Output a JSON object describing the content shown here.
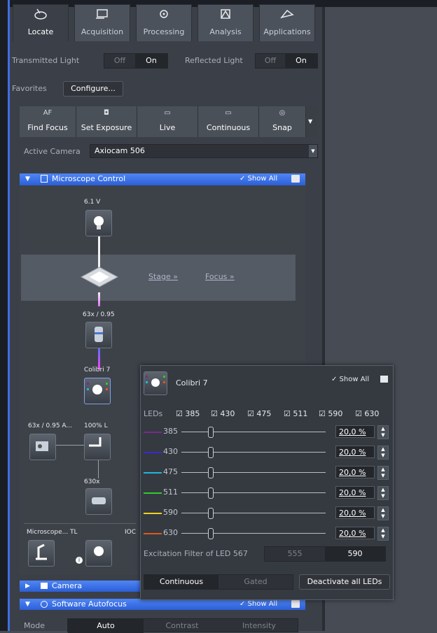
{
  "tabs": [
    {
      "label": "Locate",
      "icon": "locate-icon"
    },
    {
      "label": "Acquisition",
      "icon": "acquisition-icon"
    },
    {
      "label": "Processing",
      "icon": "processing-icon"
    },
    {
      "label": "Analysis",
      "icon": "analysis-icon"
    },
    {
      "label": "Applications",
      "icon": "applications-icon"
    }
  ],
  "light": {
    "transmitted_label": "Transmitted Light",
    "reflected_label": "Reflected Light",
    "off": "Off",
    "on": "On"
  },
  "favorites": {
    "label": "Favorites",
    "configure": "Configure..."
  },
  "toolbar": [
    {
      "icon_text": "AF",
      "label": "Find Focus"
    },
    {
      "icon_text": "◘",
      "label": "Set Exposure"
    },
    {
      "icon_text": "▭",
      "label": "Live"
    },
    {
      "icon_text": "▭",
      "label": "Continuous"
    },
    {
      "icon_text": "◎",
      "label": "Snap"
    }
  ],
  "camera": {
    "label": "Active Camera",
    "value": "Axiocam 506"
  },
  "microscope_control": {
    "title": "Microscope Control",
    "show_all": "✓ Show All",
    "lamp_voltage": "6.1 V",
    "stage_link": "Stage »",
    "focus_link": "Focus »",
    "objective": "63x / 0.95",
    "colibri": "Colibri 7",
    "objective_short": "63x / 0.95 A...",
    "lamp_percent": "100% L",
    "optovar": "630x",
    "bottom_microscope": "Microscope... TL",
    "bottom_ioc": "IOC"
  },
  "popup": {
    "title": "Colibri 7",
    "show_all": "✓ Show All",
    "leds_label": "LEDs",
    "led_checks": [
      "385",
      "430",
      "475",
      "511",
      "590",
      "630"
    ],
    "leds": [
      {
        "name": "385",
        "color": "#7a2a8c",
        "value": "20,0 %",
        "level_pct": 20
      },
      {
        "name": "430",
        "color": "#3a2ad6",
        "value": "20,0 %",
        "level_pct": 20
      },
      {
        "name": "475",
        "color": "#22b3e0",
        "value": "20,0 %",
        "level_pct": 20
      },
      {
        "name": "511",
        "color": "#2ecc2e",
        "value": "20,0 %",
        "level_pct": 20
      },
      {
        "name": "590",
        "color": "#f0d21a",
        "value": "20,0 %",
        "level_pct": 20
      },
      {
        "name": "630",
        "color": "#e0581a",
        "value": "20,0 %",
        "level_pct": 20
      }
    ],
    "excitation_label": "Excitation Filter of LED 567",
    "filter_a": "555",
    "filter_b": "590",
    "continuous": "Continuous",
    "gated": "Gated",
    "deactivate": "Deactivate all LEDs"
  },
  "camera_section": {
    "title": "Camera"
  },
  "autofocus": {
    "title": "Software Autofocus",
    "show_all": "✓ Show All",
    "mode_label": "Mode",
    "modes": [
      "Auto",
      "Contrast",
      "Intensity"
    ]
  },
  "colors": {
    "accent": "#3f6ee0",
    "header_blue": "#2c5fd8"
  }
}
